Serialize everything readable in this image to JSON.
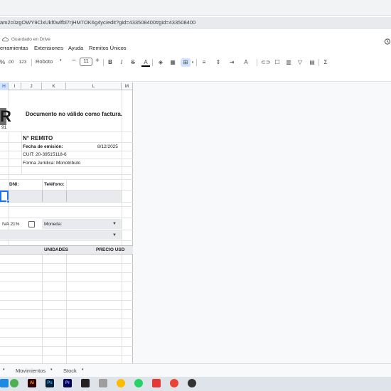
{
  "browser": {
    "url": "am2c0zgOWY9ClxUkf0wlfbl7rjHM7OK6g4yc/edit?gid=433508400#gid=433508400"
  },
  "doc": {
    "save_status": "Guardado en Drive"
  },
  "menu": {
    "items": [
      "erramientas",
      "Extensiones",
      "Ayuda",
      "Remitos Únicos"
    ]
  },
  "toolbar": {
    "zoom_label": ".00",
    "format_123": "123",
    "font": "Roboto",
    "font_size": "11",
    "minus": "−",
    "plus": "+"
  },
  "columns": {
    "labels": [
      "H",
      "I",
      "J",
      "K",
      "L",
      "M"
    ]
  },
  "sheet": {
    "logo_letter": "R",
    "logo_number": "91",
    "invalid_notice": "Documento no válido como factura.",
    "remito_label": "N° REMITO",
    "fecha_label": "Fecha de emisión:",
    "fecha_value": "8/12/2025",
    "cuit": "CUIT: 20-39515118-6",
    "forma_juridica": "Forma Jurídica: Monotributo",
    "dni_label": "DNI:",
    "telefono_label": "Teléfono:",
    "iva_label": "IVA 21%",
    "moneda_label": "Moneda:",
    "unidades_label": "UNIDADES",
    "precio_label": "PRECIO USD"
  },
  "sheet_tabs": {
    "movimientos": "Movimientos",
    "stock": "Stock"
  },
  "taskbar": {
    "ai": "Ai",
    "ps": "Ps",
    "pr": "Pr"
  },
  "colors": {
    "accent": "#1a73e8",
    "selected_col": "#d3e3fd",
    "band": "#e8eaed"
  }
}
